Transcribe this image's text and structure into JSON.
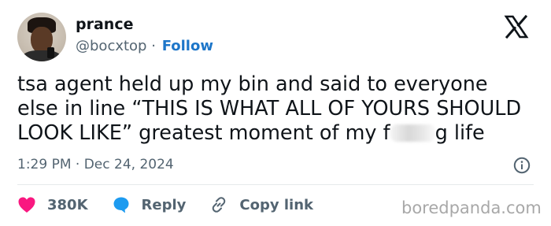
{
  "author": {
    "name": "prance",
    "handle": "@bocxtop",
    "separator": "·",
    "follow_label": "Follow"
  },
  "tweet": {
    "line1": "tsa agent held up my bin and said to everyone",
    "line2": "else in line “THIS IS WHAT ALL OF YOURS SHOULD",
    "line3_before": "LOOK LIKE” greatest moment of my f",
    "line3_after": "g life"
  },
  "meta": {
    "time": "1:29 PM",
    "separator": "·",
    "date": "Dec 24, 2024"
  },
  "actions": {
    "likes_count": "380K",
    "reply_label": "Reply",
    "copy_link_label": "Copy link"
  },
  "watermark": "boredpanda.com",
  "icons": {
    "logo": "x-logo-icon",
    "info": "info-icon",
    "like": "heart-icon",
    "reply": "speech-bubble-icon",
    "copy": "link-icon"
  },
  "colors": {
    "follow": "#1d76c9",
    "heart": "#f91880",
    "reply": "#1d9bf0",
    "muted": "#536471"
  }
}
